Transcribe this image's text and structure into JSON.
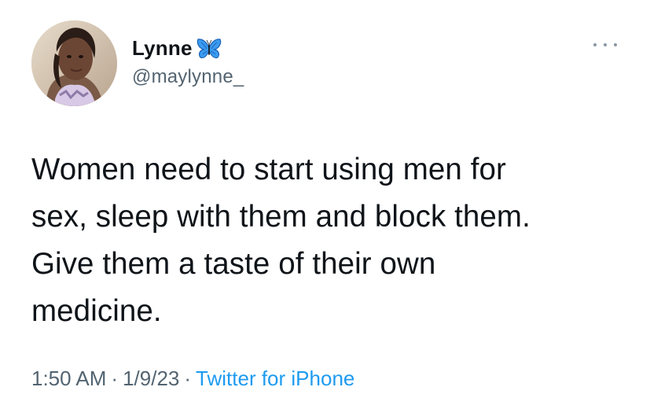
{
  "author": {
    "display_name": "Lynne",
    "handle": "@maylynne_",
    "name_emoji": "butterfly-icon"
  },
  "tweet": {
    "text": "Women need to start using men for\nsex, sleep with them and block them.\nGive them a taste of their own\nmedicine.",
    "time": "1:50 AM",
    "date": "1/9/23",
    "separator": "·",
    "source": "Twitter for iPhone"
  },
  "colors": {
    "text_primary": "#0f1419",
    "text_secondary": "#536471",
    "link": "#1d9bf0",
    "butterfly": "#3b9cf0"
  }
}
